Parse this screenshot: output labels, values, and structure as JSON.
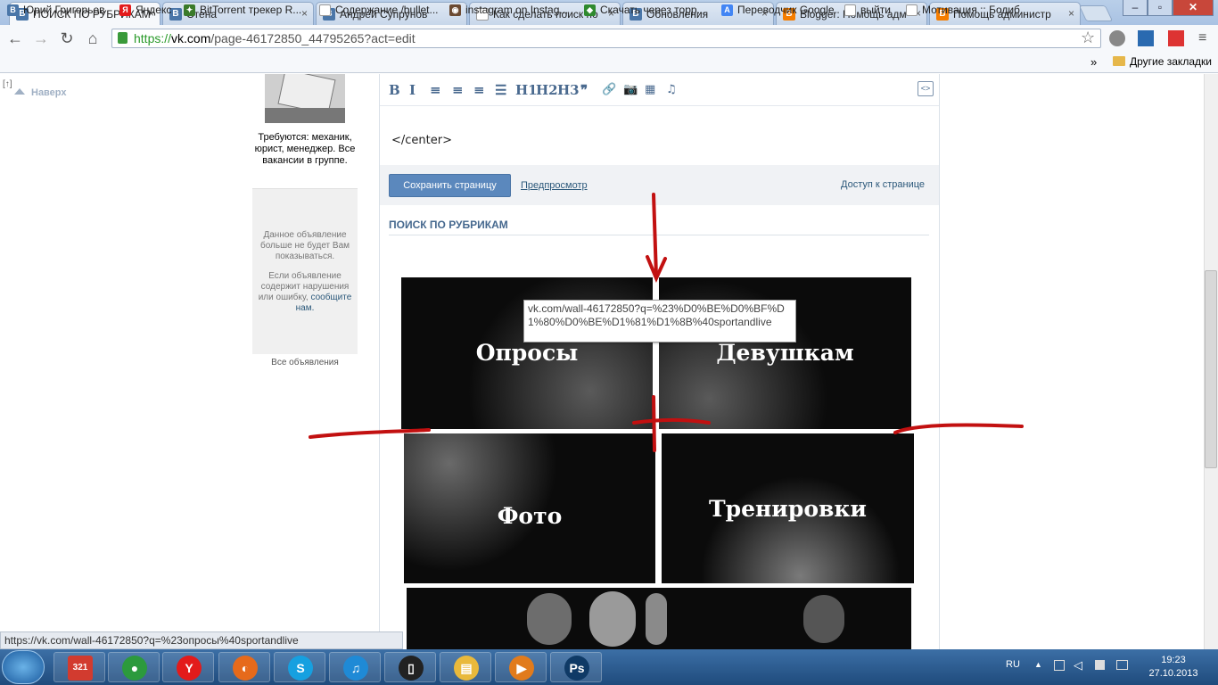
{
  "browser": {
    "tabs": [
      {
        "title": "ПОИСК ПО РУБРИКАМ",
        "favicon": "В",
        "color": "#4a76a8",
        "active": true
      },
      {
        "title": "Стена",
        "favicon": "В",
        "color": "#4a76a8"
      },
      {
        "title": "Андрей Супрунов",
        "favicon": "В",
        "color": "#4a76a8"
      },
      {
        "title": "Как сделать поиск по",
        "favicon": "",
        "color": "#ffffff"
      },
      {
        "title": "Обновления",
        "favicon": "В",
        "color": "#4a76a8"
      },
      {
        "title": "Blogger: Помощь адм",
        "favicon": "B",
        "color": "#f57d00"
      },
      {
        "title": "Помощь администр",
        "favicon": "B",
        "color": "#f57d00"
      }
    ],
    "url_scheme": "https://",
    "url_host": "vk.com",
    "url_path": "/page-46172850_44795265?act=edit",
    "bookmarks": [
      {
        "label": "Юрий Григорьев",
        "icon": "В",
        "color": "#4a76a8"
      },
      {
        "label": "Яндекс",
        "icon": "Я",
        "color": "#e31b1b"
      },
      {
        "label": "BitTorrent трекер R...",
        "icon": "✦",
        "color": "#3a7a2a"
      },
      {
        "label": "Содержание /bullet...",
        "icon": "",
        "color": "#ffffff"
      },
      {
        "label": "instagram on Instag...",
        "icon": "◉",
        "color": "#6b4a32"
      },
      {
        "label": "Скачать через торр...",
        "icon": "◆",
        "color": "#2f8a2f"
      },
      {
        "label": "Переводчик Google",
        "icon": "A",
        "color": "#4285f4"
      },
      {
        "label": "выйти",
        "icon": "",
        "color": "#ffffff"
      },
      {
        "label": "Мотивация :: Бодиб...",
        "icon": "",
        "color": "#ffffff"
      }
    ],
    "bookmarks_overflow": "»",
    "other_bookmarks": "Другие закладки",
    "status_url": "https://vk.com/wall-46172850?q=%23опросы%40sportandlive"
  },
  "left": {
    "up_label": "Наверх",
    "up_bracket": "[↑]",
    "ad_caption": "Требуются: механик, юрист, менеджер. Все вакансии в группе.",
    "ad_hidden": "Данное объявление больше не будет Вам показываться.",
    "ad_report_pre": "Если объявление содержит нарушения или ошибку,",
    "ad_report_link": "сообщите нам.",
    "all_ads": "Все объявления"
  },
  "editor": {
    "buttons": [
      "B",
      "I",
      "≡",
      "≡",
      "≡",
      "☰",
      "H1",
      "H2",
      "H3",
      "❞",
      "🔗",
      "📷",
      "▦",
      "♫"
    ],
    "source_text": "</center>",
    "save_button": "Сохранить страницу",
    "preview_link": "Предпросмотр",
    "access_link": "Доступ к странице",
    "page_title": "ПОИСК ПО РУБРИКАМ"
  },
  "tiles": [
    {
      "label": "Опросы"
    },
    {
      "label": "Девушкам"
    },
    {
      "label": "Фото"
    },
    {
      "label": "Тренировки"
    },
    {
      "label": ""
    }
  ],
  "tooltip": "vk.com/wall-46172850?q=%23%D0%BE%D0%BF%D1%80%D0%BE%D1%81%D1%8B%40sportandlive",
  "taskbar": {
    "apps": [
      {
        "name": "calendar",
        "glyph": "321",
        "color": "#d23b2f"
      },
      {
        "name": "chrome",
        "glyph": "●",
        "color": "#2c9a3d"
      },
      {
        "name": "yandex",
        "glyph": "Y",
        "color": "#e31b1b"
      },
      {
        "name": "firefox",
        "glyph": "◐",
        "color": "#e66a1b"
      },
      {
        "name": "skype",
        "glyph": "S",
        "color": "#16a0e0"
      },
      {
        "name": "itunes",
        "glyph": "♫",
        "color": "#1f8ad6"
      },
      {
        "name": "phone",
        "glyph": "▯",
        "color": "#222222"
      },
      {
        "name": "explorer",
        "glyph": "▤",
        "color": "#e9b93b"
      },
      {
        "name": "player",
        "glyph": "▶",
        "color": "#e17b1c"
      },
      {
        "name": "photoshop",
        "glyph": "Ps",
        "color": "#0f3a66"
      }
    ],
    "lang": "RU",
    "time": "19:23",
    "date": "27.10.2013"
  }
}
